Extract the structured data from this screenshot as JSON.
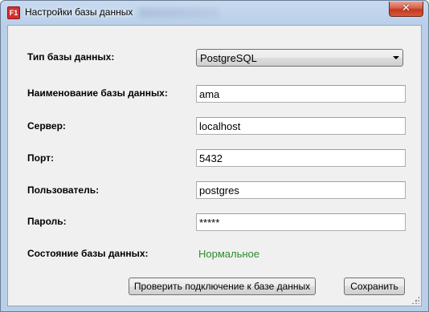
{
  "window": {
    "title": "Настройки базы данных",
    "app_icon_text": "F1",
    "close_symbol": "✕"
  },
  "form": {
    "db_type": {
      "label": "Тип базы данных:",
      "value": "PostgreSQL"
    },
    "db_name": {
      "label": "Наименование базы данных:",
      "value": "ama"
    },
    "server": {
      "label": "Сервер:",
      "value": "localhost"
    },
    "port": {
      "label": "Порт:",
      "value": "5432"
    },
    "user": {
      "label": "Пользователь:",
      "value": "postgres"
    },
    "password": {
      "label": "Пароль:",
      "value": "*****"
    },
    "status": {
      "label": "Состояние базы данных:",
      "value": "Нормальное",
      "color": "#2e8b2e"
    }
  },
  "buttons": {
    "test_connection": "Проверить подключение к базе данных",
    "save": "Сохранить"
  },
  "icons": {
    "app": "app-logo-icon",
    "close": "close-icon",
    "dropdown": "chevron-down-icon",
    "grip": "resize-grip-icon"
  }
}
